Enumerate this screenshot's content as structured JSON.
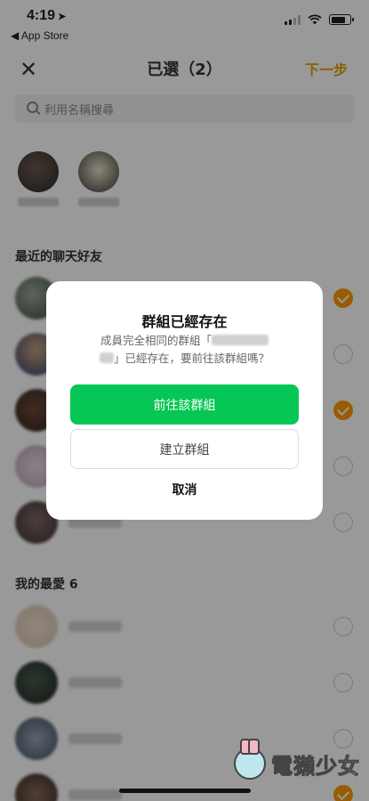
{
  "status_bar": {
    "time": "4:19",
    "back_app": "◀ App Store"
  },
  "nav": {
    "title": "已選（2）",
    "next_label": "下一步"
  },
  "search": {
    "placeholder": "利用名稱搜尋"
  },
  "sections": {
    "recent": "最近的聊天好友",
    "favorites": "我的最愛 6"
  },
  "dialog": {
    "title": "群組已經存在",
    "message_part1": "成員完全相同的群組「",
    "message_part2": "」已經存在，要前往該群組嗎？",
    "primary_button": "前往該群組",
    "secondary_button": "建立群組",
    "cancel_button": "取消"
  },
  "watermark": {
    "text": "電獺少女"
  },
  "colors": {
    "accent": "#ff9a00",
    "line_green": "#06c755"
  },
  "recent_friends": [
    {
      "selected": true
    },
    {
      "selected": false
    },
    {
      "selected": true
    },
    {
      "selected": false
    },
    {
      "selected": false
    }
  ],
  "favorite_friends": [
    {
      "selected": false
    },
    {
      "selected": false
    },
    {
      "selected": false
    },
    {
      "selected": true
    }
  ]
}
